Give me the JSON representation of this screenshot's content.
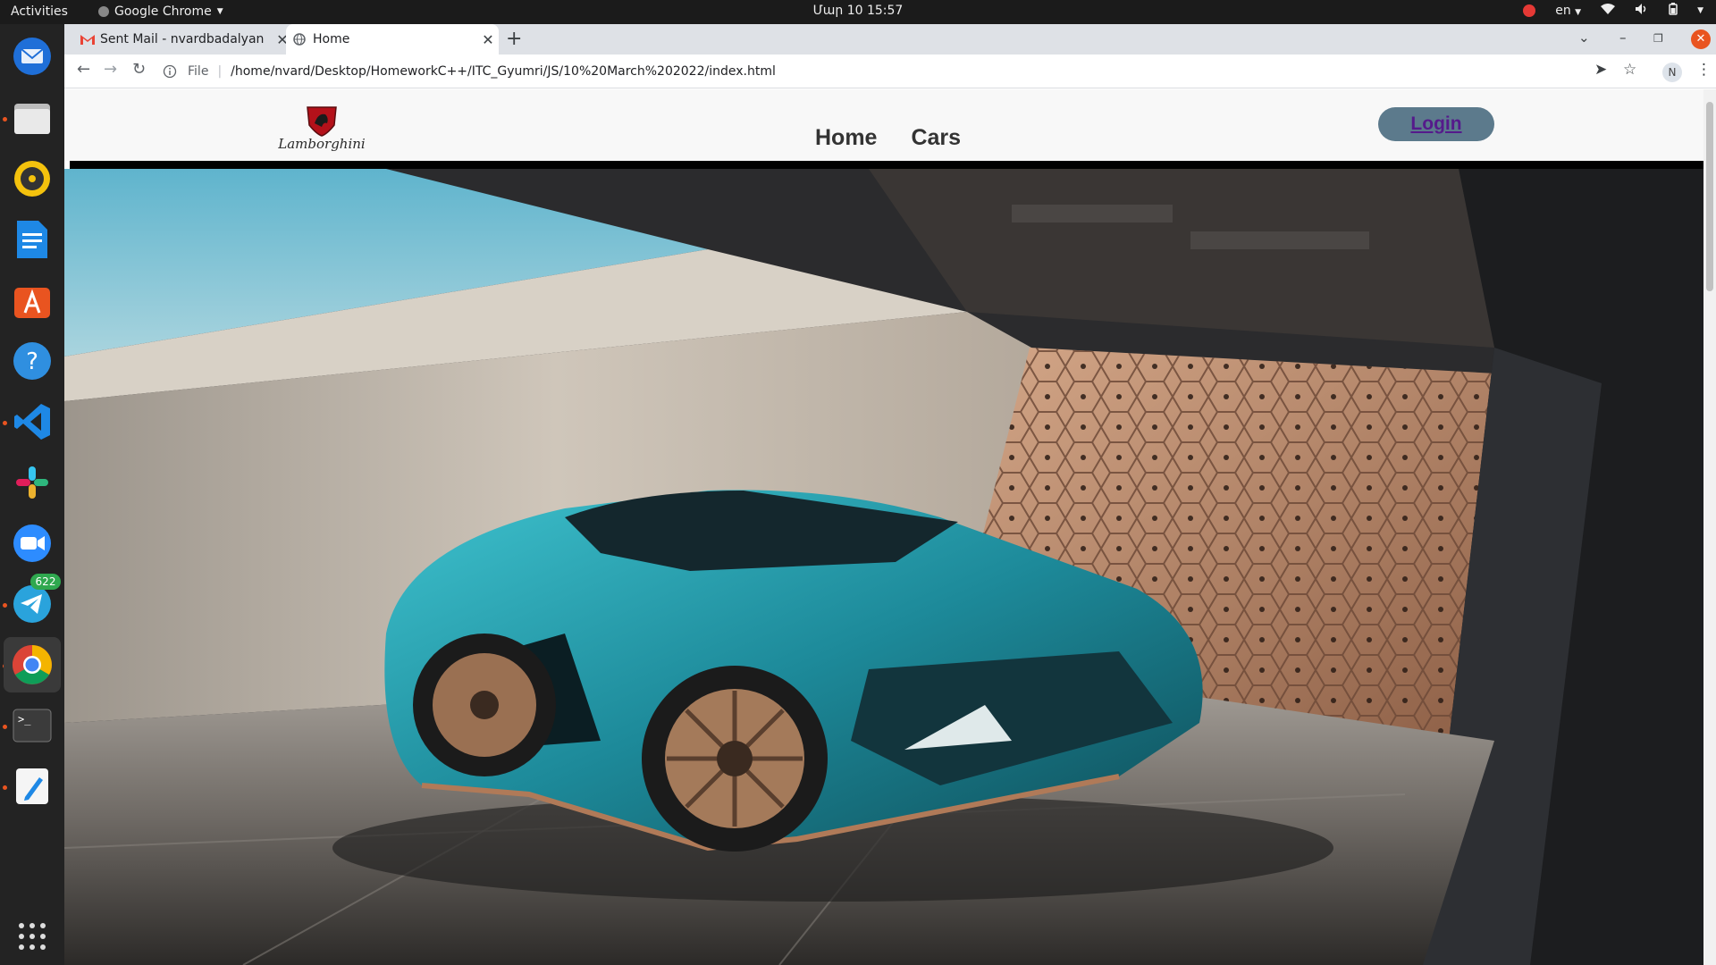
{
  "topbar": {
    "activities": "Activities",
    "app_name": "Google Chrome",
    "clock": "Մար 10  15:57",
    "lang": "en"
  },
  "dock": {
    "items": [
      "thunderbird-icon",
      "files-icon",
      "rhythmbox-icon",
      "writer-icon",
      "software-icon",
      "help-icon",
      "vscode-icon",
      "slack-icon",
      "zoom-icon",
      "telegram-icon",
      "chrome-icon",
      "terminal-icon",
      "text-editor-icon",
      "show-apps-icon"
    ],
    "telegram_badge": "622"
  },
  "browser": {
    "tabs": [
      {
        "title": "Sent Mail - nvardbadalyan",
        "active": false
      },
      {
        "title": "Home",
        "active": true
      }
    ],
    "address": {
      "scheme": "File",
      "url": "/home/nvard/Desktop/HomeworkC++/ITC_Gyumri/JS/10%20March%202022/index.html"
    },
    "profile_initial": "N"
  },
  "page": {
    "logo_text": "Lamborghini",
    "nav": [
      "Home",
      "Cars"
    ],
    "login": "Login"
  },
  "colors": {
    "login_bg": "#5c7a8c",
    "login_text": "#551a8b",
    "hero_car": "#1d8a9a"
  }
}
